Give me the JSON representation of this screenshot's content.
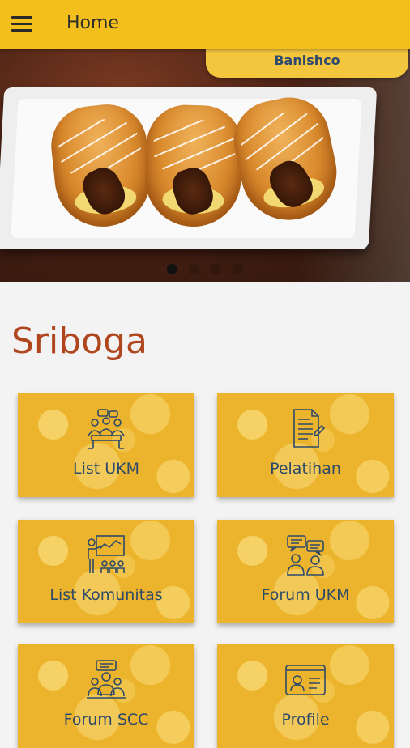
{
  "appbar": {
    "title": "Home",
    "menu_icon": "hamburger-menu-icon",
    "color": "#f3bf1d"
  },
  "hero": {
    "caption": "Banishco",
    "slides": 4,
    "active_slide": 0
  },
  "section": {
    "title": "Sriboga",
    "title_color": "#b0461e"
  },
  "menu": {
    "tile_color": "#ecb42c",
    "label_color": "#2d4a6b",
    "items": [
      {
        "label": "List UKM",
        "icon": "meeting-group-icon"
      },
      {
        "label": "Pelatihan",
        "icon": "document-icon"
      },
      {
        "label": "List Komunitas",
        "icon": "presentation-icon"
      },
      {
        "label": "Forum UKM",
        "icon": "chat-people-icon"
      },
      {
        "label": "Forum SCC",
        "icon": "group-talk-icon"
      },
      {
        "label": "Profile",
        "icon": "id-card-icon"
      }
    ]
  }
}
